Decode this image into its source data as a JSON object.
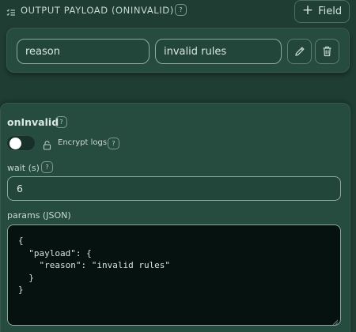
{
  "header": {
    "title": "OUTPUT PAYLOAD (ONINVALID)",
    "help_glyph": "?",
    "add_field_plus": "+",
    "add_field_label": "Field"
  },
  "payload_row": {
    "key_value": "reason",
    "value_value": "invalid rules"
  },
  "section": {
    "title": "onInvalid",
    "help_glyph": "?",
    "encrypt_logs": {
      "label": "Encrypt logs",
      "enabled": false,
      "help_glyph": "?"
    },
    "wait": {
      "label": "wait (s)",
      "help_glyph": "?",
      "value": "6"
    },
    "params": {
      "label": "params (JSON)",
      "lines": [
        "{",
        "  \"payload\": {",
        "    \"reason\": \"invalid rules\"",
        "  }",
        "}"
      ]
    }
  },
  "icons": {
    "header": "list-icon",
    "edit": "pencil-icon",
    "delete": "trash-icon",
    "lock": "lock-icon"
  },
  "colors": {
    "background": "#1f3d33",
    "card": "#264c40",
    "code_background": "#05120f",
    "toggle_knob": "#ffffff"
  }
}
